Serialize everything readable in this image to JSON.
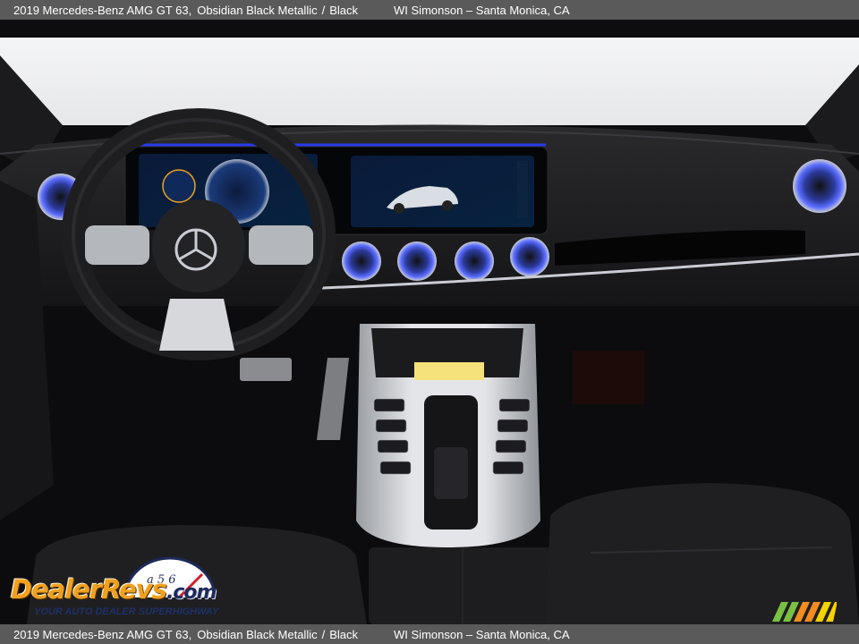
{
  "caption": {
    "title": "2019 Mercedes-Benz AMG GT 63,",
    "color": "Obsidian Black Metallic",
    "separator": "/",
    "interior": "Black",
    "dealer": "WI Simonson – Santa Monica, CA"
  },
  "watermark": {
    "brand": "DealerRevs",
    "domain": ".com",
    "tagline": "YOUR AUTO DEALER SUPERHIGHWAY",
    "gauge_digits": "a 5 6"
  },
  "photo": {
    "subject": "dashboard-interior",
    "steering_wheel_badge": "star-emblem-icon",
    "colors": {
      "ambient_blue": "#2a3cff",
      "trim_silver": "#c9ccd2",
      "dash_black": "#141416",
      "brand_orange": "#f0a020",
      "brand_navy": "#1e2a5a",
      "stripe_green": "#7ac143",
      "stripe_yellow": "#f6d200",
      "stripe_orange": "#f28c1e"
    }
  }
}
